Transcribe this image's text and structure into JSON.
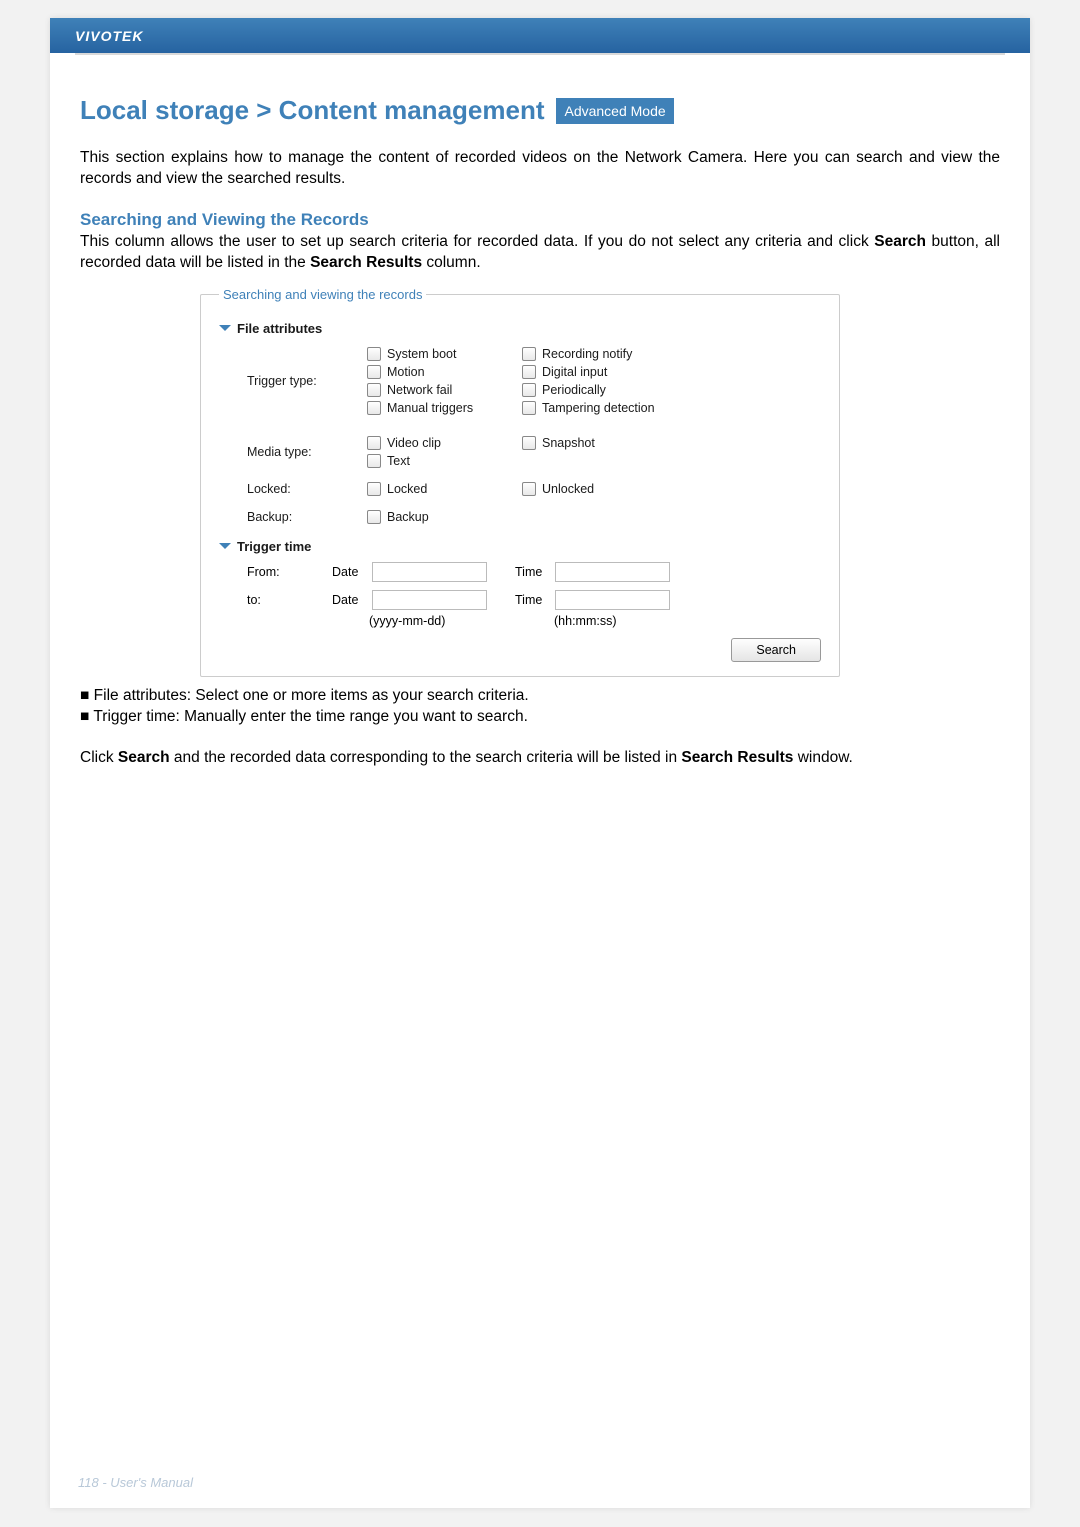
{
  "header": {
    "brand": "VIVOTEK"
  },
  "title": "Local storage > Content management",
  "badge": "Advanced Mode",
  "intro": "This section explains how to manage the content of recorded videos on the Network Camera. Here you can search and view the records and view the searched results.",
  "subhead": "Searching and Viewing the Records",
  "subtext_pre": "This column allows the user to set up search criteria for recorded data. If you do not select any criteria and click ",
  "subtext_bold1": "Search",
  "subtext_mid": " button, all recorded data will be listed in the ",
  "subtext_bold2": "Search Results",
  "subtext_end": " column.",
  "panel": {
    "legend": "Searching and viewing the records",
    "section1": "File attributes",
    "row1_label": "Trigger type:",
    "trigger": {
      "o1": "System boot",
      "o2": "Recording notify",
      "o3": "Motion",
      "o4": "Digital input",
      "o5": "Network fail",
      "o6": "Periodically",
      "o7": "Manual triggers",
      "o8": "Tampering detection"
    },
    "row2_label": "Media type:",
    "media": {
      "o1": "Video clip",
      "o2": "Snapshot",
      "o3": "Text"
    },
    "row3_label": "Locked:",
    "locked": {
      "o1": "Locked",
      "o2": "Unlocked"
    },
    "row4_label": "Backup:",
    "backup": {
      "o1": "Backup"
    },
    "section2": "Trigger time",
    "from_label": "From:",
    "to_label": "to:",
    "date_label": "Date",
    "time_label": "Time",
    "fmt_date": "(yyyy-mm-dd)",
    "fmt_time": "(hh:mm:ss)",
    "search_btn": "Search"
  },
  "bullets": {
    "b1": "■ File attributes: Select one or more items as your search criteria.",
    "b2": "■ Trigger time: Manually enter the time range you want to search."
  },
  "outro_pre": "Click ",
  "outro_bold1": "Search",
  "outro_mid": " and the recorded data corresponding to the search criteria will be listed in ",
  "outro_bold2": "Search Results",
  "outro_end": " window.",
  "footer": "118 - User's Manual"
}
